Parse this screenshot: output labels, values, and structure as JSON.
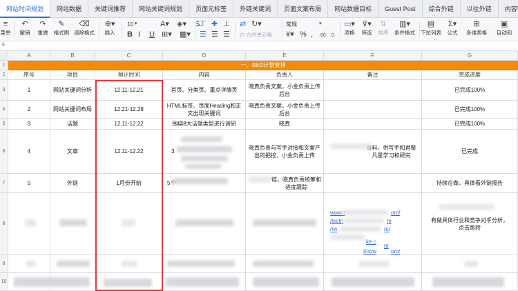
{
  "tabs": [
    {
      "label": "网站时间规划",
      "active": true
    },
    {
      "label": "网站数据"
    },
    {
      "label": "关键词推荐"
    },
    {
      "label": "网站关键词规划"
    },
    {
      "label": "页面元标签"
    },
    {
      "label": "外链关键词"
    },
    {
      "label": "页面文案布局"
    },
    {
      "label": "网站数据目标"
    },
    {
      "label": "Guest Post"
    },
    {
      "label": "综合外链"
    },
    {
      "label": "以往外链"
    },
    {
      "label": "内容营销"
    }
  ],
  "toolbar": {
    "menu": "菜单",
    "undo": "撤销",
    "redo": "重做",
    "format_painter": "格式刷",
    "clear_format": "清除格式",
    "insert": "插入",
    "font_size": "10",
    "number_format": "常规",
    "merge": "合并单元格",
    "percent": "%",
    "thousands": ",",
    "add_decimal": ".00",
    "remove_decimal": ".0",
    "add_filter": "添格",
    "filter": "筛选",
    "sort": "排序",
    "cond_format": "条件格式",
    "dropdown": "下拉列表",
    "formula": "公式",
    "multi_table": "多维表格",
    "wrap": "自动和"
  },
  "formula_bar": {
    "cell_ref": "6"
  },
  "columns": [
    "A",
    "B",
    "C",
    "D",
    "E",
    "F",
    "G"
  ],
  "row_numbers": [
    "1",
    "2",
    "3",
    "4",
    "5",
    "6",
    "7",
    "8",
    "9",
    "10"
  ],
  "banner": "一、SEO计划安排",
  "table": {
    "headers": [
      "序号",
      "项目",
      "预计时间",
      "内容",
      "负责人",
      "备注",
      "完成进度"
    ],
    "rows": [
      [
        "1",
        "网站关键词分析",
        "12.11-12.21",
        "首页、分类页、重点详情页",
        "晓真负责文案，小金负责上传后台",
        "",
        "已完成100%"
      ],
      [
        "2",
        "网站关键词布局",
        "12.21-12.28",
        "HTML标签、页面Heading和正文出现关键词",
        "晓真负责文案，小金负责上传后台",
        "",
        "已完成100%"
      ],
      [
        "3",
        "话题",
        "12.11-12.22",
        "围绕8大话题类型进行调研",
        "晓真",
        "",
        "已完成100%"
      ],
      [
        "4",
        "文章",
        "12.11-12.22",
        "3",
        "晓真负责与写手对接和文案产出的把控，小金负责上传",
        "资料，供写手和君聚凡星学习和研究",
        "已完成"
      ],
      [
        "5",
        "外链",
        "1月份开始",
        "5个",
        "链，晓真负责统筹和进度跟踪",
        "",
        "持续在做，具体看外链报告"
      ],
      [
        "",
        "",
        "",
        "",
        "",
        "",
        "有做具体行业和竞争对手分析，"
      ],
      [
        "",
        "",
        "",
        "",
        "",
        "",
        ""
      ],
      [
        "",
        "",
        "",
        "",
        "",
        "",
        ""
      ]
    ],
    "row6_link": "点击跳转",
    "link_fragments": [
      "www.r",
      "om/",
      "/lectri",
      "m",
      "//w",
      "m/",
      "ke.c",
      "nt",
      "ttnow",
      "om/"
    ]
  }
}
